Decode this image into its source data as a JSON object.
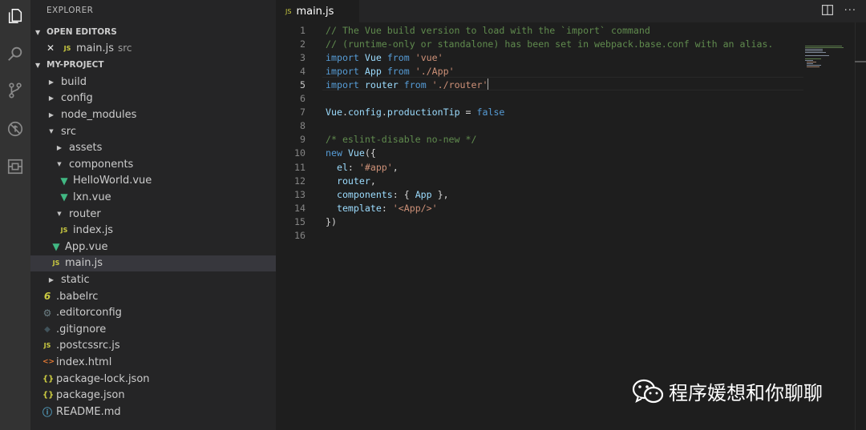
{
  "sidebar": {
    "title": "EXPLORER",
    "open_editors_label": "OPEN EDITORS",
    "open_editor": {
      "name": "main.js",
      "path": "src"
    },
    "project_label": "MY-PROJECT",
    "tree": [
      {
        "label": "build",
        "kind": "folder",
        "depth": 0,
        "icon": "chevron-right-icon"
      },
      {
        "label": "config",
        "kind": "folder",
        "depth": 0,
        "icon": "chevron-right-icon"
      },
      {
        "label": "node_modules",
        "kind": "folder",
        "depth": 0,
        "icon": "chevron-right-icon"
      },
      {
        "label": "src",
        "kind": "folder-open",
        "depth": 0,
        "icon": "chevron-down-icon"
      },
      {
        "label": "assets",
        "kind": "folder",
        "depth": 1,
        "icon": "chevron-right-icon"
      },
      {
        "label": "components",
        "kind": "folder-open",
        "depth": 1,
        "icon": "chevron-down-icon"
      },
      {
        "label": "HelloWorld.vue",
        "kind": "vue",
        "depth": 2,
        "icon": "vue-file-icon"
      },
      {
        "label": "lxn.vue",
        "kind": "vue",
        "depth": 2,
        "icon": "vue-file-icon"
      },
      {
        "label": "router",
        "kind": "folder-open",
        "depth": 1,
        "icon": "chevron-down-icon"
      },
      {
        "label": "index.js",
        "kind": "js",
        "depth": 2,
        "icon": "js-file-icon"
      },
      {
        "label": "App.vue",
        "kind": "vue",
        "depth": 1,
        "icon": "vue-file-icon"
      },
      {
        "label": "main.js",
        "kind": "js",
        "depth": 1,
        "icon": "js-file-icon",
        "selected": true
      },
      {
        "label": "static",
        "kind": "folder",
        "depth": 0,
        "icon": "chevron-right-icon"
      },
      {
        "label": ".babelrc",
        "kind": "babel",
        "depth": 0,
        "icon": "babel-file-icon"
      },
      {
        "label": ".editorconfig",
        "kind": "gear",
        "depth": 0,
        "icon": "gear-file-icon"
      },
      {
        "label": ".gitignore",
        "kind": "git",
        "depth": 0,
        "icon": "git-file-icon"
      },
      {
        "label": ".postcssrc.js",
        "kind": "js",
        "depth": 0,
        "icon": "js-file-icon"
      },
      {
        "label": "index.html",
        "kind": "html",
        "depth": 0,
        "icon": "html-file-icon"
      },
      {
        "label": "package-lock.json",
        "kind": "json",
        "depth": 0,
        "icon": "json-file-icon"
      },
      {
        "label": "package.json",
        "kind": "json",
        "depth": 0,
        "icon": "json-file-icon"
      },
      {
        "label": "README.md",
        "kind": "info",
        "depth": 0,
        "icon": "info-file-icon"
      }
    ]
  },
  "tab": {
    "label": "main.js",
    "icon": "js-file-icon"
  },
  "editor": {
    "active_line": 5,
    "lines": [
      [
        [
          "// The Vue build version to load with the `import` command",
          "com"
        ]
      ],
      [
        [
          "// (runtime-only or standalone) has been set in webpack.base.conf with an alias.",
          "com"
        ]
      ],
      [
        [
          "import",
          "kw"
        ],
        [
          " ",
          "pl"
        ],
        [
          "Vue",
          "var"
        ],
        [
          " ",
          "pl"
        ],
        [
          "from",
          "kw"
        ],
        [
          " ",
          "pl"
        ],
        [
          "'vue'",
          "str"
        ]
      ],
      [
        [
          "import",
          "kw"
        ],
        [
          " ",
          "pl"
        ],
        [
          "App",
          "var"
        ],
        [
          " ",
          "pl"
        ],
        [
          "from",
          "kw"
        ],
        [
          " ",
          "pl"
        ],
        [
          "'./App'",
          "str"
        ]
      ],
      [
        [
          "import",
          "kw"
        ],
        [
          " ",
          "pl"
        ],
        [
          "router",
          "var"
        ],
        [
          " ",
          "pl"
        ],
        [
          "from",
          "kw"
        ],
        [
          " ",
          "pl"
        ],
        [
          "'./router'",
          "str"
        ]
      ],
      [],
      [
        [
          "Vue",
          "var"
        ],
        [
          ".",
          "pl"
        ],
        [
          "config",
          "var"
        ],
        [
          ".",
          "pl"
        ],
        [
          "productionTip",
          "var"
        ],
        [
          " = ",
          "pl"
        ],
        [
          "false",
          "kw"
        ]
      ],
      [],
      [
        [
          "/* eslint-disable no-new */",
          "com"
        ]
      ],
      [
        [
          "new",
          "kw"
        ],
        [
          " ",
          "pl"
        ],
        [
          "Vue",
          "var"
        ],
        [
          "({",
          "pl"
        ]
      ],
      [
        [
          "  el",
          "var"
        ],
        [
          ": ",
          "pl"
        ],
        [
          "'#app'",
          "str"
        ],
        [
          ",",
          "pl"
        ]
      ],
      [
        [
          "  router",
          "var"
        ],
        [
          ",",
          "pl"
        ]
      ],
      [
        [
          "  components",
          "var"
        ],
        [
          ": { ",
          "pl"
        ],
        [
          "App",
          "var"
        ],
        [
          " },",
          "pl"
        ]
      ],
      [
        [
          "  template",
          "var"
        ],
        [
          ": ",
          "pl"
        ],
        [
          "'<App/>'",
          "str"
        ]
      ],
      [
        [
          "})",
          "pl"
        ]
      ],
      []
    ]
  },
  "watermark": {
    "text": "程序媛想和你聊聊",
    "icon": "wechat-logo-icon"
  },
  "colors": {
    "comment": "#608b4e",
    "keyword": "#569cd6",
    "variable": "#9cdcfe",
    "string": "#ce9178",
    "vue": "#41b883",
    "js": "#cbcb41"
  }
}
